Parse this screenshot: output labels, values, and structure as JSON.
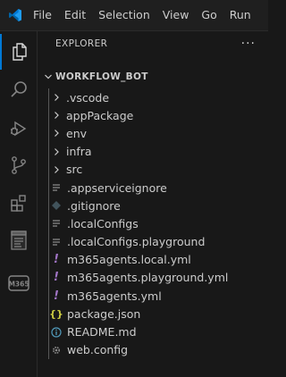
{
  "menu": [
    "File",
    "Edit",
    "Selection",
    "View",
    "Go",
    "Run"
  ],
  "explorer": {
    "title": "EXPLORER",
    "more": "···",
    "workspace": "WORKFLOW_BOT"
  },
  "tree": [
    {
      "label": ".vscode",
      "kind": "folder"
    },
    {
      "label": "appPackage",
      "kind": "folder"
    },
    {
      "label": "env",
      "kind": "folder"
    },
    {
      "label": "infra",
      "kind": "folder"
    },
    {
      "label": "src",
      "kind": "folder"
    },
    {
      "label": ".appserviceignore",
      "kind": "file",
      "icon": "lines-icon"
    },
    {
      "label": ".gitignore",
      "kind": "file",
      "icon": "git-icon"
    },
    {
      "label": ".localConfigs",
      "kind": "file",
      "icon": "lines-icon"
    },
    {
      "label": ".localConfigs.playground",
      "kind": "file",
      "icon": "lines-icon"
    },
    {
      "label": "m365agents.local.yml",
      "kind": "file",
      "icon": "yaml-icon"
    },
    {
      "label": "m365agents.playground.yml",
      "kind": "file",
      "icon": "yaml-icon"
    },
    {
      "label": "m365agents.yml",
      "kind": "file",
      "icon": "yaml-icon"
    },
    {
      "label": "package.json",
      "kind": "file",
      "icon": "json-icon"
    },
    {
      "label": "README.md",
      "kind": "file",
      "icon": "info-icon"
    },
    {
      "label": "web.config",
      "kind": "file",
      "icon": "gear-icon"
    }
  ],
  "activity": [
    "explorer-icon",
    "search-icon",
    "run-debug-icon",
    "source-control-icon",
    "extensions-icon",
    "notepad-icon",
    "m365-icon"
  ],
  "colors": {
    "accent": "#0078d4",
    "yaml": "#a074c4",
    "json": "#cbcb41",
    "info": "#519aba"
  }
}
